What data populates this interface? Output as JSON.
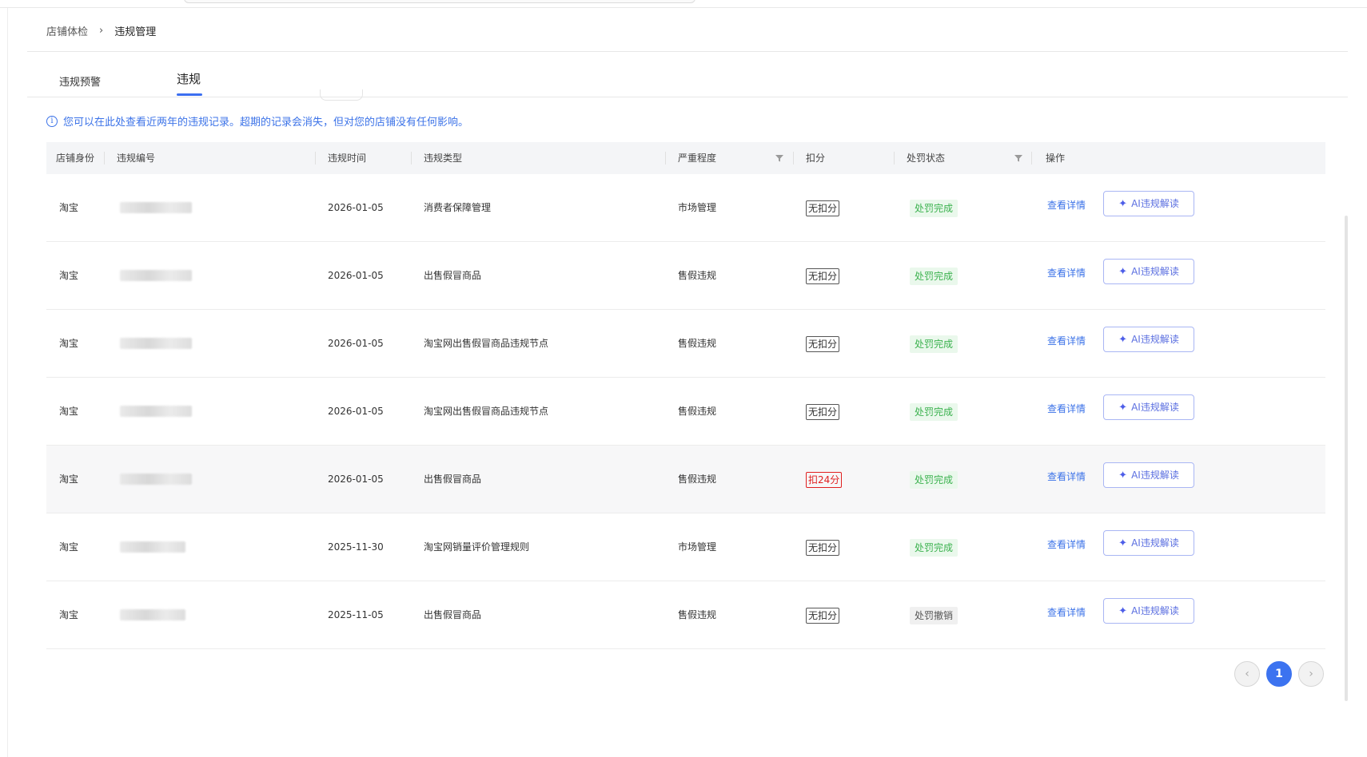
{
  "breadcrumb": {
    "parent": "店铺体检",
    "separator": "›",
    "current": "违规管理"
  },
  "tabs": [
    {
      "label": "违规预警",
      "active": false
    },
    {
      "label": "违规",
      "active": true
    }
  ],
  "notice": {
    "icon": "info-icon",
    "text": "您可以在此处查看近两年的违规记录。超期的记录会消失，但对您的店铺没有任何影响。"
  },
  "table": {
    "headers": {
      "shop_identity": "店铺身份",
      "violation_no": "违规编号",
      "violation_time": "违规时间",
      "violation_type": "违规类型",
      "severity": "严重程度",
      "deduction": "扣分",
      "penalty_status": "处罚状态",
      "actions": "操作"
    },
    "rows": [
      {
        "shop": "淘宝",
        "time": "2026-01-05",
        "type": "消费者保障管理",
        "severity": "市场管理",
        "deduction": "无扣分",
        "status": "处罚完成",
        "detail": "查看详情",
        "ai": "AI违规解读"
      },
      {
        "shop": "淘宝",
        "time": "2026-01-05",
        "type": "出售假冒商品",
        "severity": "售假违规",
        "deduction": "无扣分",
        "status": "处罚完成",
        "detail": "查看详情",
        "ai": "AI违规解读"
      },
      {
        "shop": "淘宝",
        "time": "2026-01-05",
        "type": "淘宝网出售假冒商品违规节点",
        "severity": "售假违规",
        "deduction": "无扣分",
        "status": "处罚完成",
        "detail": "查看详情",
        "ai": "AI违规解读"
      },
      {
        "shop": "淘宝",
        "time": "2026-01-05",
        "type": "淘宝网出售假冒商品违规节点",
        "severity": "售假违规",
        "deduction": "无扣分",
        "status": "处罚完成",
        "detail": "查看详情",
        "ai": "AI违规解读"
      },
      {
        "shop": "淘宝",
        "time": "2026-01-05",
        "type": "出售假冒商品",
        "severity": "售假违规",
        "deduction": "扣24分",
        "status": "处罚完成",
        "detail": "查看详情",
        "ai": "AI违规解读"
      },
      {
        "shop": "淘宝",
        "time": "2025-11-30",
        "type": "淘宝网销量评价管理规则",
        "severity": "市场管理",
        "deduction": "无扣分",
        "status": "处罚完成",
        "detail": "查看详情",
        "ai": "AI违规解读"
      },
      {
        "shop": "淘宝",
        "time": "2025-11-05",
        "type": "出售假冒商品",
        "severity": "售假违规",
        "deduction": "无扣分",
        "status": "处罚撤销",
        "detail": "查看详情",
        "ai": "AI违规解读"
      }
    ]
  },
  "pagination": {
    "prev": "‹",
    "current_page": "1",
    "next": "›"
  },
  "colors": {
    "accent": "#3c73f0",
    "success_bg": "#eaf8ec",
    "success_text": "#3cb24f",
    "danger": "#e02020"
  }
}
